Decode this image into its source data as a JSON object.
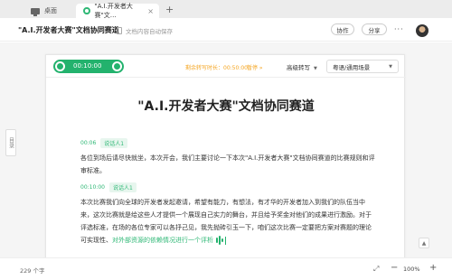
{
  "browser": {
    "tabs": [
      {
        "label": "桌面",
        "icon": "monitor-icon"
      },
      {
        "label": "\"A.I.开发者大赛\"文…",
        "icon": "recording-icon"
      }
    ],
    "new_tab_symbol": "+",
    "close_symbol": "×"
  },
  "header": {
    "title": "\"A.I.开发者大赛\"文档协同赛道",
    "autosave": "文档内容自动保存",
    "collab_label": "协作",
    "share_label": "分享",
    "more_symbol": "···"
  },
  "outline_tab": "目录",
  "player": {
    "time": "00:10:00",
    "recording_status": "剩余转写时长：00:50:00",
    "pause_label": "暂停 »",
    "mode": "高级转写",
    "language": "粤语/通用场景",
    "accent_color": "#23b26d"
  },
  "document": {
    "heading": "\"A.I.开发者大赛\"文档协同赛道",
    "segments": [
      {
        "time": "00:06",
        "speaker": "说话人1",
        "text": "各位到场后请尽快就坐，本次开会，我们主要讨论一下本次\"A.I.开发者大赛\"文档协同赛道的比赛规则和评审标准。"
      },
      {
        "time": "00:10:00",
        "speaker": "说话人1",
        "text": "本次比赛我们向全球的开发者发起邀请，希望有能力，有想法，有才华的开发者加入到我们的队伍当中来，这次比赛就是给这些人才提供一个展现自己实力的舞台，并且给予奖金对他们的成果进行激励。对于评选标准，在场的各位专家可以各抒己见，我先抛砖引玉一下，咱们这次比赛一定要把方案对赛题的理论可实现性、",
        "live_text": "对外部资源的依赖情况进行一个评析"
      }
    ]
  },
  "statusbar": {
    "word_count": "229 个字",
    "zoom": "100%",
    "zoom_out": "−",
    "zoom_in": "+"
  }
}
